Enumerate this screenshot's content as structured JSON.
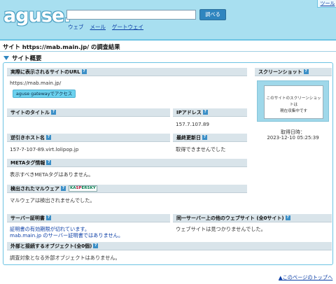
{
  "header": {
    "logo": "aguse.",
    "search_button": "調べる",
    "nav": [
      "ウェブ",
      "メール",
      "ゲートウェイ"
    ],
    "tool_tab": "ツール"
  },
  "page_title": "サイト https://mab.main.jp/ の調査結果",
  "section_title": "サイト概要",
  "boxes": {
    "url": {
      "title": "実際に表示されるサイトのURL",
      "value": "https://mab.main.jp/",
      "gateway_button": "aguse gatewayでアクセス"
    },
    "site_title": {
      "title": "サイトのタイトル",
      "value": ""
    },
    "ip": {
      "title": "IPアドレス",
      "value": "157.7.107.89"
    },
    "reverse": {
      "title": "逆引きホスト名",
      "value": "157-7-107-89.virt.lolipop.jp"
    },
    "updated": {
      "title": "最終更新日",
      "value": "取得できませんでした"
    },
    "meta": {
      "title": "METAタグ情報",
      "value": "表示すべきMETAタグはありません。"
    },
    "malware": {
      "title": "検出されたマルウェア",
      "badge_a": "KA",
      "badge_b": "SP",
      "badge_c": "ERSKY",
      "value": "マルウェアは検出されませんでした。"
    },
    "cert": {
      "title": "サーバー証明書",
      "line1": "証明書の有効期限が切れています。",
      "line2": "mab.main.jp のサーバー証明書ではありません。"
    },
    "same_server": {
      "title": "同一サーバー上の他のウェブサイト (全0サイト)",
      "value": "ウェブサイトは見つかりませんでした。"
    },
    "external": {
      "title": "外部と接続するオブジェクト(全0個)",
      "value": "調査対象となる外部オブジェクトはありません。"
    }
  },
  "screenshot": {
    "title": "スクリーンショット",
    "placeholder_line1": "このサイトのスクリーンショットは",
    "placeholder_line2": "現在収集中です",
    "date_label": "取得日時：",
    "date_value": "2023-12-10 05:25:39"
  },
  "footer": {
    "top_link": "▲このページのトップへ"
  },
  "colors": {
    "header_bg": "#a8dff0",
    "accent": "#2f85bf",
    "box_head": "#d9e4ea"
  }
}
